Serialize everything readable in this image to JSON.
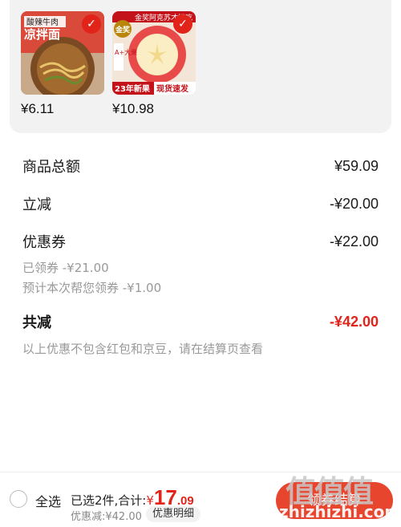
{
  "products": [
    {
      "price": "¥6.11",
      "image_label_top": "酸辣牛肉",
      "image_label_main": "凉拌面",
      "icon": "check-icon"
    },
    {
      "price": "¥10.98",
      "image_label_top": "金奖阿克苏才好吃",
      "image_badge": "金奖",
      "image_label_bottom_left": "23年新果",
      "image_label_bottom_right": "现货速发",
      "image_side": "A+大果",
      "icon": "check-icon"
    }
  ],
  "summary": {
    "goods_total_label": "商品总额",
    "goods_total_value": "¥59.09",
    "instant_off_label": "立减",
    "instant_off_value": "-¥20.00",
    "coupon_label": "优惠券",
    "coupon_value": "-¥22.00",
    "coupon_received": "已领券 -¥21.00",
    "coupon_estimated": "预计本次帮您领券 -¥1.00",
    "total_off_label": "共减",
    "total_off_value": "-¥42.00",
    "note": "以上优惠不包含红包和京豆，请在结算页查看"
  },
  "bottom_bar": {
    "select_all": "全选",
    "selected_text": "已选2件,合计:",
    "currency": "¥",
    "total_int": "17",
    "total_dec": ".09",
    "saved_text": "优惠减:¥42.00",
    "detail_button": "优惠明细",
    "checkout_button": "领券结算",
    "watermark_top": "值值值",
    "watermark_bottom": "zhizhizhi.com"
  },
  "colors": {
    "accent_red": "#e2231a",
    "checkout_red": "#e8452f",
    "muted_text": "#999999"
  }
}
